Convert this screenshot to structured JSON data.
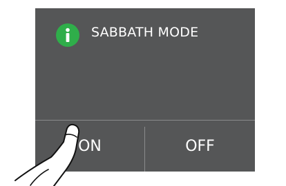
{
  "dialog": {
    "title": "SABBATH MODE",
    "info_icon": "info-icon",
    "accent_color": "#2fae4a",
    "panel_color": "#555657"
  },
  "buttons": {
    "on_label": "ON",
    "off_label": "OFF"
  },
  "pointer": {
    "icon": "pointing-hand-icon"
  }
}
